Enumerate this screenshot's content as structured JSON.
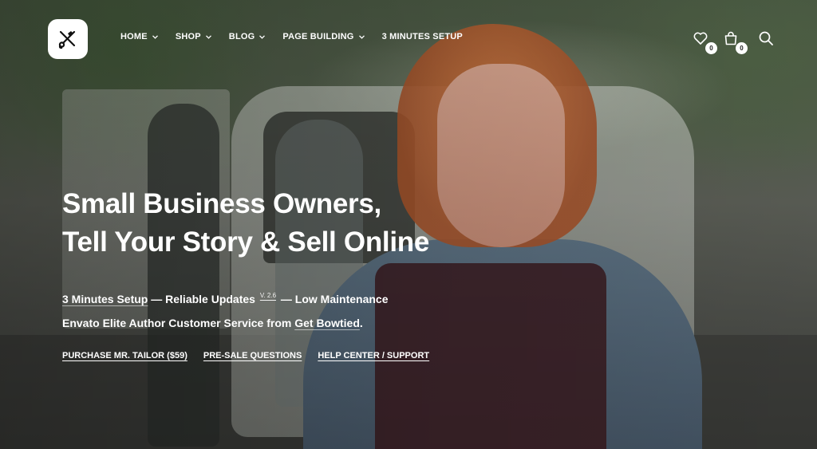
{
  "header": {
    "logo_icon": "tailor-scissors-needle-icon",
    "nav": [
      {
        "label": "HOME",
        "has_dropdown": true
      },
      {
        "label": "SHOP",
        "has_dropdown": true
      },
      {
        "label": "BLOG",
        "has_dropdown": true
      },
      {
        "label": "PAGE BUILDING",
        "has_dropdown": true
      },
      {
        "label": "3 MINUTES SETUP",
        "has_dropdown": false
      }
    ],
    "wishlist_count": "0",
    "cart_count": "0",
    "icons": [
      "heart-icon",
      "shopping-bag-icon",
      "search-icon"
    ]
  },
  "hero": {
    "headline_line1": "Small Business Owners,",
    "headline_line2": "Tell Your Story & Sell Online",
    "tag1_setup": "3 Minutes Setup",
    "tag1_sep1": " — Reliable Updates ",
    "tag1_version": "V. 2.6",
    "tag1_sep2": " — Low Maintenance",
    "tag2_prefix": "Envato Elite Author Customer Service from ",
    "tag2_link": "Get Bowtied",
    "tag2_suffix": ".",
    "links": [
      {
        "label": "PURCHASE MR. TAILOR ($59)"
      },
      {
        "label": "PRE-SALE QUESTIONS"
      },
      {
        "label": "HELP CENTER / SUPPORT"
      }
    ]
  }
}
